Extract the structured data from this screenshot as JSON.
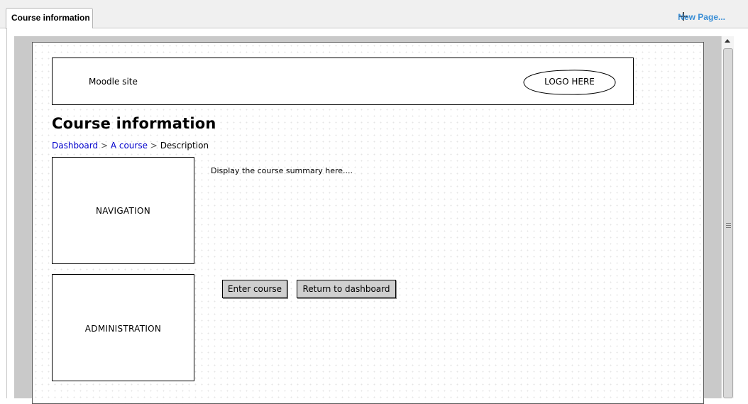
{
  "tabs": [
    {
      "label": "Course information"
    }
  ],
  "new_page": {
    "label": "New Page...",
    "icon": "plus-icon"
  },
  "mockup": {
    "header": {
      "site_name": "Moodle site",
      "logo_text": "LOGO HERE"
    },
    "page_title": "Course information",
    "breadcrumb": {
      "items": [
        "Dashboard",
        "A course",
        "Description"
      ],
      "separator": ">"
    },
    "blocks": {
      "navigation": "NAVIGATION",
      "administration": "ADMINISTRATION"
    },
    "summary_text": "Display the course summary here....",
    "buttons": {
      "enter": "Enter course",
      "return": "Return to dashboard"
    }
  },
  "colors": {
    "link": "#0000cc",
    "new_page_accent": "#3b8fd6",
    "button_fill": "#cfcfcf"
  }
}
